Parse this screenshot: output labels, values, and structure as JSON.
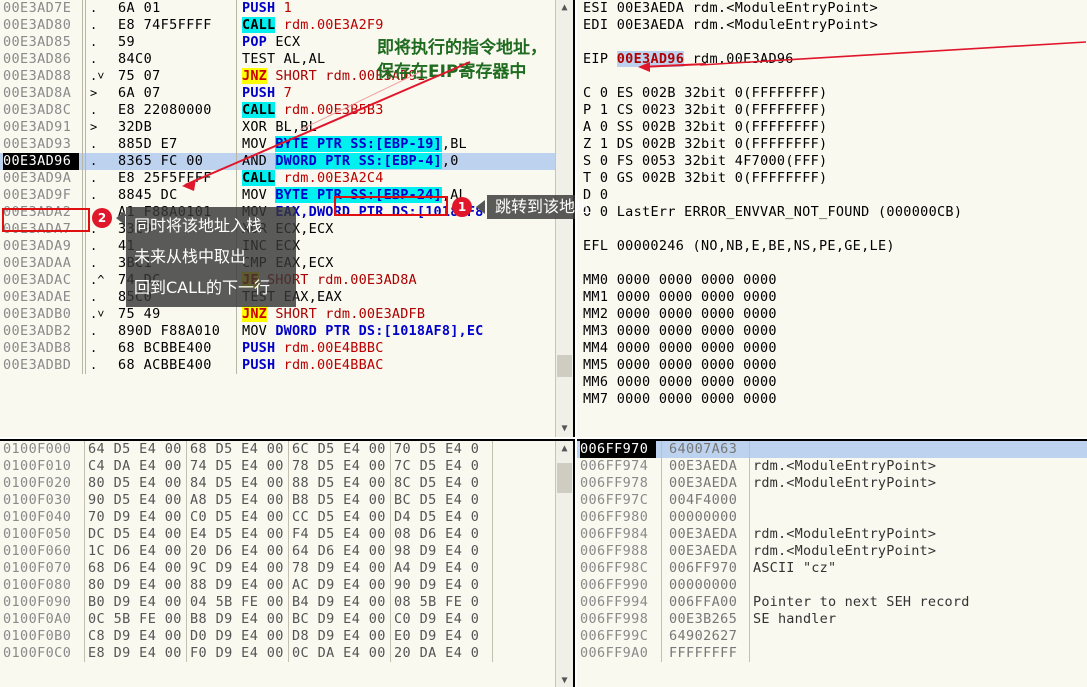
{
  "disassembly": {
    "rows": [
      {
        "addr": "00E3AD7E",
        "mark": ".",
        "bytes": "6A 01",
        "mn": "PUSH",
        "mn_cls": "mn-blue",
        "op": "1",
        "op_cls": "op-red"
      },
      {
        "addr": "00E3AD80",
        "mark": ".",
        "bytes": "E8 74F5FFFF",
        "mn": "CALL",
        "mn_cls": "hl-cyan-k",
        "op": "rdm.00E3A2F9",
        "op_cls": "op-red"
      },
      {
        "addr": "00E3AD85",
        "mark": ".",
        "bytes": "59",
        "mn": "POP",
        "mn_cls": "mn-blue",
        "op": "ECX",
        "op_cls": "mn-black"
      },
      {
        "addr": "00E3AD86",
        "mark": ".",
        "bytes": "84C0",
        "mn": "TEST",
        "mn_cls": "mn-black",
        "op": "AL,AL",
        "op_cls": "mn-black"
      },
      {
        "addr": "00E3AD88",
        "mark": ".˅",
        "bytes": "75 07",
        "mn": "JNZ",
        "mn_cls": "hl-yellow",
        "op": "SHORT rdm.00E3AD91",
        "op_cls": "op-dkred"
      },
      {
        "addr": "00E3AD8A",
        "mark": ">",
        "bytes": "6A 07",
        "mn": "PUSH",
        "mn_cls": "mn-blue",
        "op": "7",
        "op_cls": "op-red"
      },
      {
        "addr": "00E3AD8C",
        "mark": ".",
        "bytes": "E8 22080000",
        "mn": "CALL",
        "mn_cls": "hl-cyan-k",
        "op": "rdm.00E3B5B3",
        "op_cls": "op-red"
      },
      {
        "addr": "00E3AD91",
        "mark": ">",
        "bytes": "32DB",
        "mn": "XOR",
        "mn_cls": "mn-black",
        "op": "BL,BL",
        "op_cls": "mn-black"
      },
      {
        "addr": "00E3AD93",
        "mark": ".",
        "bytes": "885D E7",
        "mn": "MOV",
        "mn_cls": "mn-black",
        "op": "BYTE PTR SS:[EBP-19]",
        "op_cls": "hl-cyan",
        "op2": ",BL"
      },
      {
        "addr": "00E3AD96",
        "mark": ".",
        "bytes": "8365 FC 00",
        "mn": "AND",
        "mn_cls": "mn-black",
        "op": "DWORD PTR SS:[EBP-4]",
        "op_cls": "hl-cyan",
        "op2": ",0",
        "current": true
      },
      {
        "addr": "00E3AD9A",
        "mark": ".",
        "bytes": "E8 25F5FFFF",
        "mn": "CALL",
        "mn_cls": "hl-cyan-k",
        "op": "rdm.00E3A2C4",
        "op_cls": "op-red"
      },
      {
        "addr": "00E3AD9F",
        "mark": ".",
        "bytes": "8845 DC",
        "mn": "MOV",
        "mn_cls": "mn-black",
        "op": "BYTE PTR SS:[EBP-24]",
        "op_cls": "hl-cyan",
        "op2": ",AL"
      },
      {
        "addr": "00E3ADA2",
        "mark": ".",
        "bytes": "A1 F88A0101",
        "mn": "MOV",
        "mn_cls": "mn-black",
        "op": "EAX,DWORD PTR DS:[1018AF8",
        "op_cls": "blue-op"
      },
      {
        "addr": "00E3ADA7",
        "mark": ".",
        "bytes": "33C9",
        "mn": "XOR",
        "mn_cls": "mn-black",
        "op": "ECX,ECX",
        "op_cls": "mn-black"
      },
      {
        "addr": "00E3ADA9",
        "mark": ".",
        "bytes": "41",
        "mn": "INC",
        "mn_cls": "mn-black",
        "op": "ECX",
        "op_cls": "mn-black"
      },
      {
        "addr": "00E3ADAA",
        "mark": ".",
        "bytes": "3BC1",
        "mn": "CMP",
        "mn_cls": "mn-black",
        "op": "EAX,ECX",
        "op_cls": "mn-black"
      },
      {
        "addr": "00E3ADAC",
        "mark": ".^",
        "bytes": "74 DC",
        "mn": "JE",
        "mn_cls": "hl-yellow",
        "op": "SHORT rdm.00E3AD8A",
        "op_cls": "op-dkred"
      },
      {
        "addr": "00E3ADAE",
        "mark": ".",
        "bytes": "85C0",
        "mn": "TEST",
        "mn_cls": "mn-black",
        "op": "EAX,EAX",
        "op_cls": "mn-black"
      },
      {
        "addr": "00E3ADB0",
        "mark": ".˅",
        "bytes": "75 49",
        "mn": "JNZ",
        "mn_cls": "hl-yellow",
        "op": "SHORT rdm.00E3ADFB",
        "op_cls": "op-dkred"
      },
      {
        "addr": "00E3ADB2",
        "mark": ".",
        "bytes": "890D F88A010",
        "mn": "MOV",
        "mn_cls": "mn-black",
        "op": "DWORD PTR DS:[1018AF8],EC",
        "op_cls": "blue-op"
      },
      {
        "addr": "00E3ADB8",
        "mark": ".",
        "bytes": "68 BCBBE400",
        "mn": "PUSH",
        "mn_cls": "mn-blue",
        "op": "rdm.00E4BBBC",
        "op_cls": "op-red"
      },
      {
        "addr": "00E3ADBD",
        "mark": ".",
        "bytes": "68 ACBBE400",
        "mn": "PUSH",
        "mn_cls": "mn-blue",
        "op": "rdm.00E4BBAC",
        "op_cls": "op-red"
      }
    ]
  },
  "registers": {
    "rows": [
      {
        "name": "ESI",
        "value": "00E3AEDA",
        "comment": "rdm.<ModuleEntryPoint>"
      },
      {
        "name": "EDI",
        "value": "00E3AEDA",
        "comment": "rdm.<ModuleEntryPoint>"
      },
      {
        "name": "",
        "value": "",
        "comment": ""
      },
      {
        "name": "EIP",
        "value": "00E3AD96",
        "comment": "rdm.00E3AD96",
        "highlight": true
      }
    ],
    "flags": [
      {
        "flag": "C",
        "bit": "0",
        "seg": "ES",
        "selv": "002B",
        "mode": "32bit",
        "base": "0(FFFFFFFF)"
      },
      {
        "flag": "P",
        "bit": "1",
        "seg": "CS",
        "selv": "0023",
        "mode": "32bit",
        "base": "0(FFFFFFFF)"
      },
      {
        "flag": "A",
        "bit": "0",
        "seg": "SS",
        "selv": "002B",
        "mode": "32bit",
        "base": "0(FFFFFFFF)"
      },
      {
        "flag": "Z",
        "bit": "1",
        "seg": "DS",
        "selv": "002B",
        "mode": "32bit",
        "base": "0(FFFFFFFF)"
      },
      {
        "flag": "S",
        "bit": "0",
        "seg": "FS",
        "selv": "0053",
        "mode": "32bit",
        "base": "4F7000(FFF)"
      },
      {
        "flag": "T",
        "bit": "0",
        "seg": "GS",
        "selv": "002B",
        "mode": "32bit",
        "base": "0(FFFFFFFF)"
      },
      {
        "flag": "D",
        "bit": "0",
        "seg": "",
        "selv": "",
        "mode": "",
        "base": ""
      },
      {
        "flag": "O",
        "bit": "0",
        "seg": "",
        "selv": "",
        "mode": "",
        "base": "",
        "lasterr": "LastErr ERROR_ENVVAR_NOT_FOUND (000000CB)"
      }
    ],
    "efl": "EFL 00000246 (NO,NB,E,BE,NS,PE,GE,LE)",
    "mmx": [
      {
        "name": "MM0",
        "value": "0000 0000 0000 0000"
      },
      {
        "name": "MM1",
        "value": "0000 0000 0000 0000"
      },
      {
        "name": "MM2",
        "value": "0000 0000 0000 0000"
      },
      {
        "name": "MM3",
        "value": "0000 0000 0000 0000"
      },
      {
        "name": "MM4",
        "value": "0000 0000 0000 0000"
      },
      {
        "name": "MM5",
        "value": "0000 0000 0000 0000"
      },
      {
        "name": "MM6",
        "value": "0000 0000 0000 0000"
      },
      {
        "name": "MM7",
        "value": "0000 0000 0000 0000"
      }
    ]
  },
  "dump": {
    "rows": [
      {
        "addr": "0100F000",
        "g": [
          "64 D5 E4 00",
          "68 D5 E4 00",
          "6C D5 E4 00",
          "70 D5 E4 0"
        ]
      },
      {
        "addr": "0100F010",
        "g": [
          "C4 DA E4 00",
          "74 D5 E4 00",
          "78 D5 E4 00",
          "7C D5 E4 0"
        ]
      },
      {
        "addr": "0100F020",
        "g": [
          "80 D5 E4 00",
          "84 D5 E4 00",
          "88 D5 E4 00",
          "8C D5 E4 0"
        ]
      },
      {
        "addr": "0100F030",
        "g": [
          "90 D5 E4 00",
          "A8 D5 E4 00",
          "B8 D5 E4 00",
          "BC D5 E4 0"
        ]
      },
      {
        "addr": "0100F040",
        "g": [
          "70 D9 E4 00",
          "C0 D5 E4 00",
          "CC D5 E4 00",
          "D4 D5 E4 0"
        ]
      },
      {
        "addr": "0100F050",
        "g": [
          "DC D5 E4 00",
          "E4 D5 E4 00",
          "F4 D5 E4 00",
          "08 D6 E4 0"
        ]
      },
      {
        "addr": "0100F060",
        "g": [
          "1C D6 E4 00",
          "20 D6 E4 00",
          "64 D6 E4 00",
          "98 D9 E4 0"
        ]
      },
      {
        "addr": "0100F070",
        "g": [
          "68 D6 E4 00",
          "9C D9 E4 00",
          "78 D9 E4 00",
          "A4 D9 E4 0"
        ]
      },
      {
        "addr": "0100F080",
        "g": [
          "80 D9 E4 00",
          "88 D9 E4 00",
          "AC D9 E4 00",
          "90 D9 E4 0"
        ]
      },
      {
        "addr": "0100F090",
        "g": [
          "B0 D9 E4 00",
          "04 5B FE 00",
          "B4 D9 E4 00",
          "08 5B FE 0"
        ]
      },
      {
        "addr": "0100F0A0",
        "g": [
          "0C 5B FE 00",
          "B8 D9 E4 00",
          "BC D9 E4 00",
          "C0 D9 E4 0"
        ]
      },
      {
        "addr": "0100F0B0",
        "g": [
          "C8 D9 E4 00",
          "D0 D9 E4 00",
          "D8 D9 E4 00",
          "E0 D9 E4 0"
        ]
      },
      {
        "addr": "0100F0C0",
        "g": [
          "E8 D9 E4 00",
          "F0 D9 E4 00",
          "0C DA E4 00",
          "20 DA E4 0"
        ]
      }
    ]
  },
  "stack": {
    "rows": [
      {
        "addr": "006FF970",
        "value": "64007A63",
        "comment": "",
        "selected": true
      },
      {
        "addr": "006FF974",
        "value": "00E3AEDA",
        "comment": "rdm.<ModuleEntryPoint>"
      },
      {
        "addr": "006FF978",
        "value": "00E3AEDA",
        "comment": "rdm.<ModuleEntryPoint>"
      },
      {
        "addr": "006FF97C",
        "value": "004F4000",
        "comment": ""
      },
      {
        "addr": "006FF980",
        "value": "00000000",
        "comment": ""
      },
      {
        "addr": "006FF984",
        "value": "00E3AEDA",
        "comment": "rdm.<ModuleEntryPoint>"
      },
      {
        "addr": "006FF988",
        "value": "00E3AEDA",
        "comment": "rdm.<ModuleEntryPoint>"
      },
      {
        "addr": "006FF98C",
        "value": "006FF970",
        "comment": "ASCII \"cz\""
      },
      {
        "addr": "006FF990",
        "value": "00000000",
        "comment": ""
      },
      {
        "addr": "006FF994",
        "value": "006FFA00",
        "comment": "Pointer to next SEH record"
      },
      {
        "addr": "006FF998",
        "value": "00E3B265",
        "comment": "SE handler"
      },
      {
        "addr": "006FF99C",
        "value": "64902627",
        "comment": ""
      },
      {
        "addr": "006FF9A0",
        "value": "FFFFFFFF",
        "comment": ""
      }
    ]
  },
  "annotations": {
    "green_line1": "即将执行的指令地址，",
    "green_line2": "保存在EIP寄存器中",
    "tooltip1": "跳转到该地址",
    "tooltip2_line1": "同时将该地址入栈",
    "tooltip2_line2": "未来从栈中取出",
    "tooltip2_line3": "回到CALL的下一行",
    "badge1": "1",
    "badge2": "2",
    "accent_red": "#e0162b",
    "accent_green": "#1f6b1f"
  }
}
